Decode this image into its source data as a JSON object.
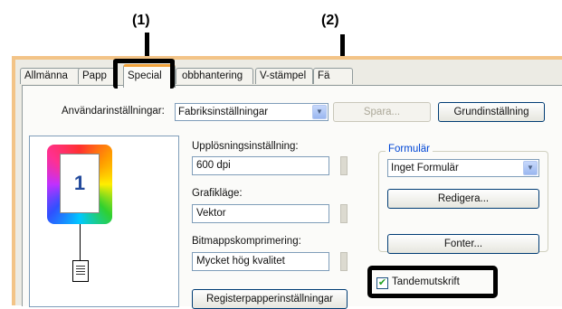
{
  "callouts": [
    "(1)",
    "(2)"
  ],
  "tabs": [
    "Allmänna",
    "Papp",
    "Special",
    "obbhantering",
    "V-stämpel",
    "Fä"
  ],
  "user_settings": {
    "label": "Användarinställningar:",
    "value": "Fabriksinställningar",
    "save_label": "Spara...",
    "default_label": "Grundinställning"
  },
  "preview": {
    "page_number": "1"
  },
  "resolution": {
    "label": "Upplösningsinställning:",
    "value": "600 dpi"
  },
  "graphics": {
    "label": "Grafikläge:",
    "value": "Vektor"
  },
  "bitmap": {
    "label": "Bitmappskomprimering:",
    "value": "Mycket hög kvalitet"
  },
  "tab_paper_button": "Registerpapperinställningar",
  "form": {
    "group_title": "Formulär",
    "value": "Inget Formulär",
    "edit_label": "Redigera..."
  },
  "fonts_label": "Fonter...",
  "tandem": {
    "label": "Tandemutskrift",
    "checked": true
  }
}
